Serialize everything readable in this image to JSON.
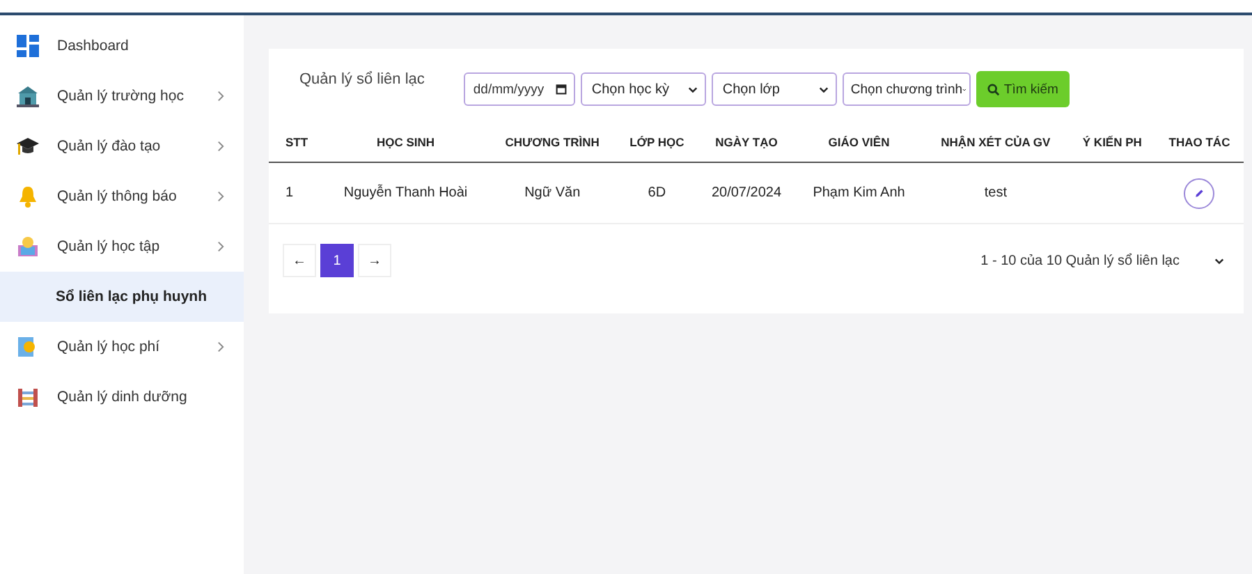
{
  "sidebar": {
    "items": [
      {
        "label": "Dashboard",
        "kind": "link",
        "selected": false
      },
      {
        "label": "Quản lý trường học",
        "kind": "group",
        "selected": false
      },
      {
        "label": "Quản lý đào tạo",
        "kind": "group",
        "selected": false
      },
      {
        "label": "Quản lý thông báo",
        "kind": "group",
        "selected": false
      },
      {
        "label": "Quản lý học tập",
        "kind": "group",
        "selected": false
      },
      {
        "label": "Sổ liên lạc phụ huynh",
        "kind": "sub",
        "selected": true
      },
      {
        "label": "Quản lý học phí",
        "kind": "group",
        "selected": false
      },
      {
        "label": "Quản lý dinh dưỡng",
        "kind": "link",
        "selected": false
      }
    ]
  },
  "filters": {
    "title": "Quản lý sổ liên lạc",
    "date": {
      "placeholder": "dd/mm/yyyy"
    },
    "selects": [
      "Chọn học kỳ",
      "Chọn lớp",
      "Chọn chương trình"
    ],
    "search_button": "Tìm kiếm"
  },
  "table": {
    "columns": [
      "STT",
      "HỌC SINH",
      "CHƯƠNG TRÌNH",
      "LỚP HỌC",
      "NGÀY TẠO",
      "GIÁO VIÊN",
      "NHẬN XÉT CỦA GV",
      "Ý KIẾN PH",
      "THAO TÁC"
    ],
    "rows": [
      [
        "1",
        "Nguyễn Thanh Hoài",
        "Ngữ Văn",
        "6D",
        "20/07/2024",
        "Phạm Kim Anh",
        "test",
        ""
      ]
    ]
  },
  "pagination": {
    "prev": "←",
    "pages": [
      {
        "label": "1",
        "selected": true
      }
    ],
    "next": "→",
    "summary": "1 - 10 của 10 Quản lý sổ liên lạc"
  }
}
